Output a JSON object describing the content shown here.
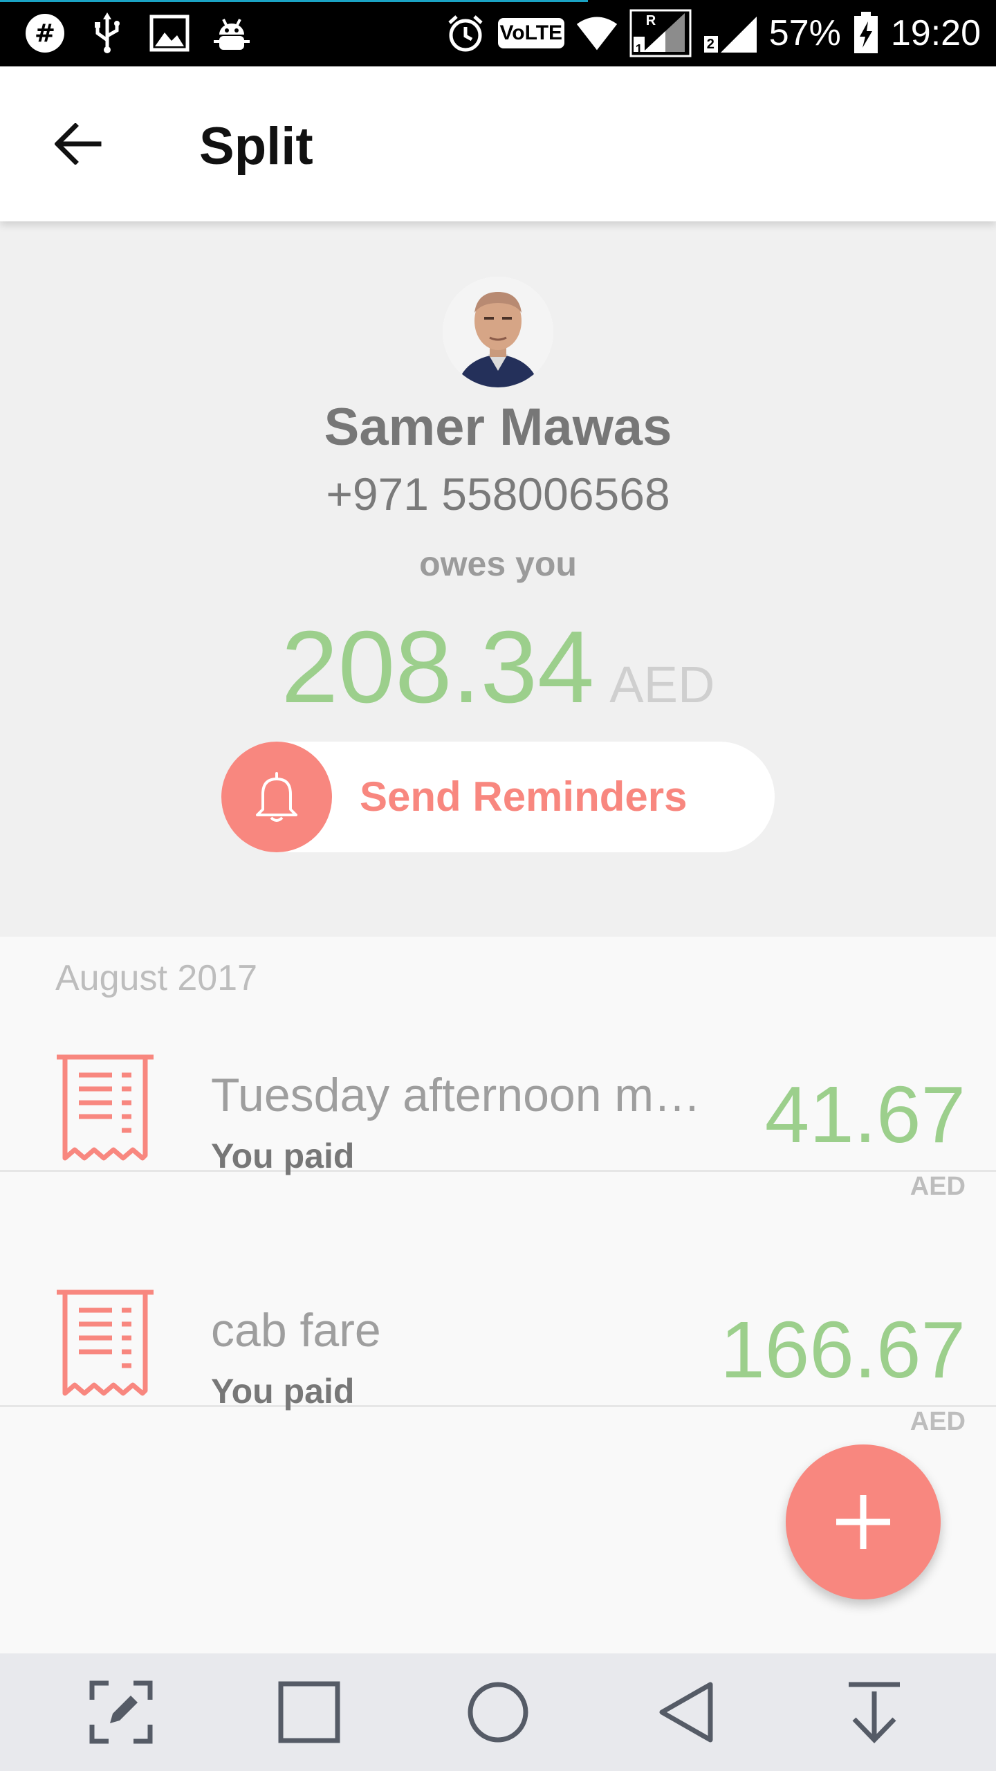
{
  "status_bar": {
    "battery": "57%",
    "time": "19:20",
    "volte": "VoLTE",
    "sim1_label": "1",
    "sim1_roaming": "R",
    "sim2_label": "2"
  },
  "app_bar": {
    "title": "Split"
  },
  "profile": {
    "name": "Samer Mawas",
    "phone": "+971 558006568",
    "relation": "owes you",
    "amount": "208.34",
    "currency": "AED",
    "reminder_label": "Send Reminders"
  },
  "transactions": {
    "section": "August 2017",
    "items": [
      {
        "title": "Tuesday afternoon m…",
        "subtitle": "You paid",
        "amount": "41.67",
        "currency": "AED"
      },
      {
        "title": "cab fare",
        "subtitle": "You paid",
        "amount": "166.67",
        "currency": "AED"
      }
    ]
  },
  "colors": {
    "accent": "#f8877f",
    "positive": "#9ccf8c",
    "muted": "#9e9e9e"
  },
  "icons": {
    "back": "arrow-left-icon",
    "reminder": "bell-icon",
    "transaction": "receipt-icon",
    "fab": "plus-icon"
  }
}
